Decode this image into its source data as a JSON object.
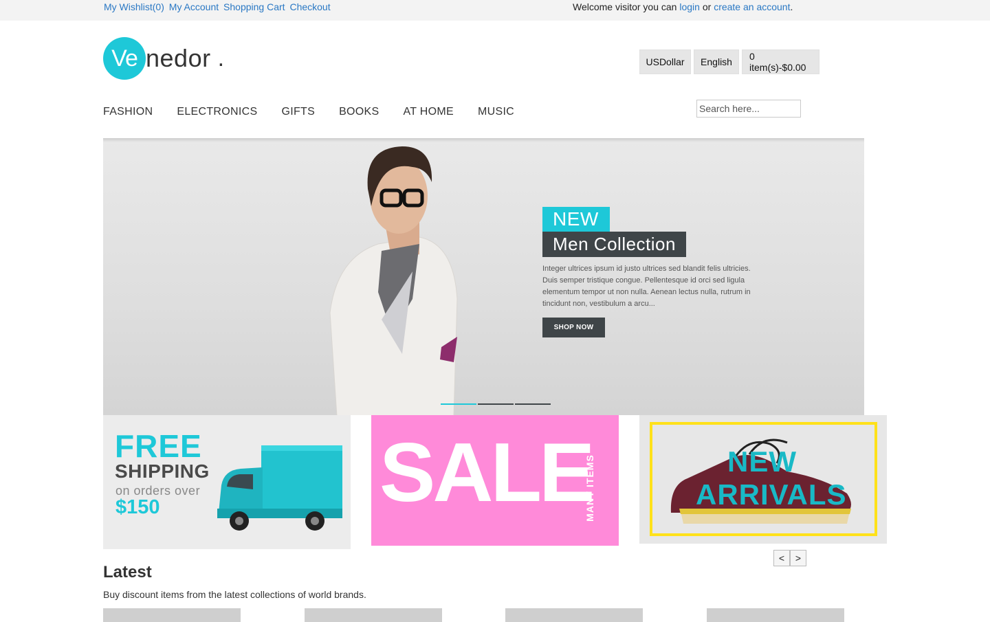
{
  "topbar": {
    "links": [
      "My Wishlist(0)",
      "My Account",
      "Shopping Cart",
      "Checkout"
    ],
    "welcome_prefix": "Welcome visitor you can",
    "login_label": "login",
    "or_label": "or",
    "create_account_label": "create an account",
    "welcome_suffix": "."
  },
  "logo": {
    "circle_text": "Ve",
    "rest_text": "nedor",
    "dot": "."
  },
  "header": {
    "currency": "USDollar",
    "language": "English",
    "cart": "0 item(s)-$0.00"
  },
  "nav": {
    "items": [
      "FASHION",
      "ELECTRONICS",
      "GIFTS",
      "BOOKS",
      "AT HOME",
      "MUSIC"
    ]
  },
  "search": {
    "placeholder": "Search here..."
  },
  "hero": {
    "tag1": "NEW",
    "tag2": "Men Collection",
    "description": "Integer ultrices ipsum id justo ultrices sed blandit felis ultricies. Duis semper tristique congue. Pellentesque id orci sed ligula elementum tempor ut non nulla. Aenean lectus nulla, rutrum in tincidunt non, vestibulum a arcu...",
    "button": "SHOP NOW",
    "active_slide": 1,
    "slide_count": 3
  },
  "promos": {
    "shipping": {
      "line1": "FREE",
      "line2": "SHIPPING",
      "line3": "on orders over",
      "line4": "$150"
    },
    "sale": {
      "big": "SALE",
      "side": "MANY ITEMS"
    },
    "new_arrivals": {
      "line1": "NEW",
      "line2": "ARRIVALS"
    }
  },
  "carousel": {
    "prev": "<",
    "next": ">"
  },
  "latest": {
    "title": "Latest",
    "description": "Buy discount items from the latest collections of world brands."
  },
  "colors": {
    "accent": "#1ec8d8",
    "dark": "#3f4548",
    "link": "#2a78c4",
    "sale_pink": "#ff8ad9",
    "frame_yellow": "#ffe11a"
  }
}
